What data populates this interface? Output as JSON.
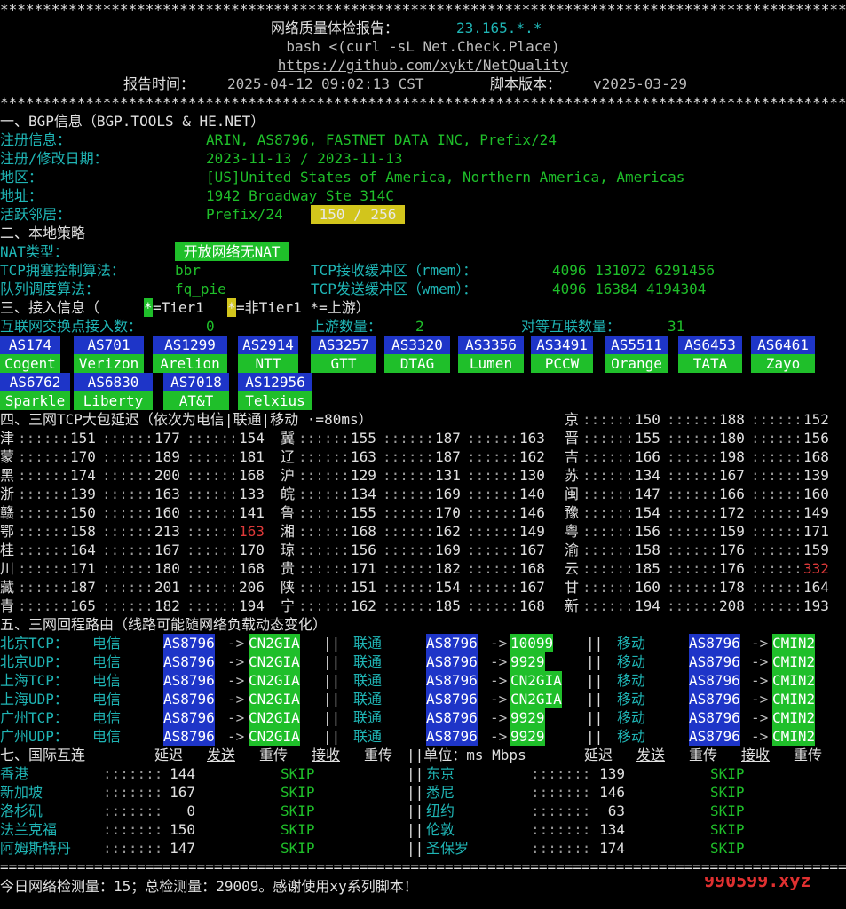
{
  "header": {
    "stars": "****************************************************************************************************************",
    "title_label": "网络质量体检报告：",
    "title_ip": "23.165.*.*",
    "cmd": "bash <(curl -sL Net.Check.Place)",
    "url": "https://github.com/xykt/NetQuality",
    "time_label": "报告时间：",
    "time_value": "2025-04-12 09:02:13 CST",
    "ver_label": "脚本版本：",
    "ver_value": "v2025-03-29"
  },
  "bgp": {
    "heading": "一、BGP信息（BGP.TOOLS & HE.NET）",
    "reg_label": "注册信息：",
    "reg_value": "ARIN, AS8796, FASTNET DATA INC, Prefix/24",
    "date_label": "注册/修改日期：",
    "date_value": "2023-11-13 / 2023-11-13",
    "region_label": "地区：",
    "region_value": "[US]United States of America, Northern America, Americas",
    "addr_label": "地址：",
    "addr_value": "1942 Broadway Ste 314C",
    "neighbor_label": "活跃邻居：",
    "neighbor_prefix": "Prefix/24",
    "neighbor_value": " 150 / 256 "
  },
  "policy": {
    "heading": "二、本地策略",
    "nat_label": "NAT类型：",
    "nat_value": " 开放网络无NAT ",
    "cc_label": "TCP拥塞控制算法：",
    "cc_value": "bbr",
    "rmem_label": "TCP接收缓冲区（rmem）：",
    "rmem_value": "4096 131072 6291456",
    "qd_label": "队列调度算法：",
    "qd_value": "fq_pie",
    "wmem_label": "TCP发送缓冲区（wmem）：",
    "wmem_value": "4096 16384 4194304"
  },
  "access": {
    "heading_a": "三、接入信息（",
    "star1": "*",
    "tier1": "=Tier1 ",
    "star2": "*",
    "nontier1": "=非Tier1 *=上游）",
    "ix_label": "互联网交换点接入数：",
    "ix_value": "0",
    "up_label": "上游数量：",
    "up_value": "2",
    "peer_label": "对等互联数量：",
    "peer_value": "31",
    "as_row1": [
      "AS174",
      "AS701",
      "AS1299",
      "AS2914",
      "AS3257",
      "AS3320",
      "AS3356",
      "AS3491",
      "AS5511",
      "AS6453",
      "AS6461"
    ],
    "name_row1": [
      "Cogent",
      "Verizon",
      "Arelion",
      "NTT",
      "GTT",
      "DTAG",
      "Lumen",
      "PCCW",
      "Orange",
      "TATA",
      "Zayo"
    ],
    "as_row2": [
      "AS6762",
      "AS6830",
      "AS7018",
      "AS12956"
    ],
    "name_row2": [
      "Sparkle",
      "Liberty",
      "AT&T",
      "Telxius"
    ]
  },
  "latency": {
    "heading": "四、三网TCP大包延迟（依次为电信|联通|移动 ·=80ms）",
    "rows": [
      [
        {
          "p": "津",
          "a": "151",
          "b": "177",
          "c": "154"
        },
        {
          "p": "冀",
          "a": "155",
          "b": "187",
          "c": "163"
        },
        {
          "p": "晋",
          "a": "155",
          "b": "180",
          "c": "156"
        }
      ],
      [
        {
          "p": "蒙",
          "a": "170",
          "b": "189",
          "c": "181"
        },
        {
          "p": "辽",
          "a": "163",
          "b": "187",
          "c": "162"
        },
        {
          "p": "吉",
          "a": "166",
          "b": "198",
          "c": "168"
        }
      ],
      [
        {
          "p": "黑",
          "a": "174",
          "b": "200",
          "c": "168"
        },
        {
          "p": "沪",
          "a": "129",
          "b": "131",
          "c": "130"
        },
        {
          "p": "苏",
          "a": "134",
          "b": "167",
          "c": "139"
        }
      ],
      [
        {
          "p": "浙",
          "a": "139",
          "b": "163",
          "c": "133"
        },
        {
          "p": "皖",
          "a": "134",
          "b": "169",
          "c": "140"
        },
        {
          "p": "闽",
          "a": "147",
          "b": "166",
          "c": "160"
        }
      ],
      [
        {
          "p": "赣",
          "a": "150",
          "b": "160",
          "c": "141"
        },
        {
          "p": "鲁",
          "a": "155",
          "b": "170",
          "c": "146"
        },
        {
          "p": "豫",
          "a": "154",
          "b": "172",
          "c": "149"
        }
      ],
      [
        {
          "p": "鄂",
          "a": "158",
          "b": "213",
          "c": "163"
        },
        {
          "p": "湘",
          "a": "168",
          "b": "162",
          "c": "149"
        },
        {
          "p": "粤",
          "a": "156",
          "b": "159",
          "c": "171"
        }
      ],
      [
        {
          "p": "桂",
          "a": "164",
          "b": "167",
          "c": "170"
        },
        {
          "p": "琼",
          "a": "156",
          "b": "169",
          "c": "167"
        },
        {
          "p": "渝",
          "a": "158",
          "b": "176",
          "c": "159"
        }
      ],
      [
        {
          "p": "川",
          "a": "171",
          "b": "180",
          "c": "168"
        },
        {
          "p": "贵",
          "a": "171",
          "b": "182",
          "c": "168"
        },
        {
          "p": "云",
          "a": "185",
          "b": "176",
          "c": "332"
        }
      ],
      [
        {
          "p": "藏",
          "a": "187",
          "b": "201",
          "c": "206"
        },
        {
          "p": "陕",
          "a": "151",
          "b": "154",
          "c": "167"
        },
        {
          "p": "甘",
          "a": "160",
          "b": "178",
          "c": "164"
        }
      ],
      [
        {
          "p": "青",
          "a": "165",
          "b": "182",
          "c": "194"
        },
        {
          "p": "宁",
          "a": "162",
          "b": "185",
          "c": "168"
        },
        {
          "p": "新",
          "a": "194",
          "b": "208",
          "c": "193"
        }
      ]
    ],
    "jing": {
      "p": "京",
      "a": "150",
      "b": "188",
      "c": "152"
    }
  },
  "route": {
    "heading": "五、三网回程路由（线路可能随网络负载动态变化）",
    "rows": [
      {
        "label": "北京TCP：",
        "ct": "CN2GIA",
        "cu": "10099",
        "cm": "CMIN2"
      },
      {
        "label": "北京UDP：",
        "ct": "CN2GIA",
        "cu": "9929",
        "cm": "CMIN2"
      },
      {
        "label": "上海TCP：",
        "ct": "CN2GIA",
        "cu": "CN2GIA",
        "cm": "CMIN2"
      },
      {
        "label": "上海UDP：",
        "ct": "CN2GIA",
        "cu": "CN2GIA",
        "cm": "CMIN2"
      },
      {
        "label": "广州TCP：",
        "ct": "CN2GIA",
        "cu": "9929",
        "cm": "CMIN2"
      },
      {
        "label": "广州UDP：",
        "ct": "CN2GIA",
        "cu": "9929",
        "cm": "CMIN2"
      }
    ],
    "asn": "AS8796",
    "arrow": "->",
    "sep": "||",
    "isp_ct": "电信",
    "isp_cu": "联通",
    "isp_cm": "移动"
  },
  "intl": {
    "heading": "七、国际互连",
    "col_hdr": [
      "延迟",
      "发送",
      "重传",
      "接收",
      "重传"
    ],
    "unit": "||单位：ms Mbps",
    "left": [
      {
        "city": "香港",
        "lat": "144",
        "skip": "SKIP"
      },
      {
        "city": "新加坡",
        "lat": "167",
        "skip": "SKIP"
      },
      {
        "city": "洛杉矶",
        "lat": "0",
        "skip": "SKIP"
      },
      {
        "city": "法兰克福",
        "lat": "150",
        "skip": "SKIP"
      },
      {
        "city": "阿姆斯特丹",
        "lat": "147",
        "skip": "SKIP"
      }
    ],
    "right": [
      {
        "city": "东京",
        "lat": "139",
        "skip": "SKIP"
      },
      {
        "city": "悉尼",
        "lat": "146",
        "skip": "SKIP"
      },
      {
        "city": "纽约",
        "lat": "63",
        "skip": "SKIP"
      },
      {
        "city": "伦敦",
        "lat": "134",
        "skip": "SKIP"
      },
      {
        "city": "圣保罗",
        "lat": "174",
        "skip": "SKIP"
      }
    ]
  },
  "footer": {
    "rule": "================================================================================================================",
    "text": "今日网络检测量：15；总检测量：29009。感谢使用xy系列脚本！",
    "watermark": "990599.xyz"
  },
  "colors": {
    "green": "#1fbf2a",
    "cyan": "#1fb5b5",
    "yellow": "#d2c51c",
    "blue": "#1e35c8",
    "red": "#e03a3a"
  }
}
